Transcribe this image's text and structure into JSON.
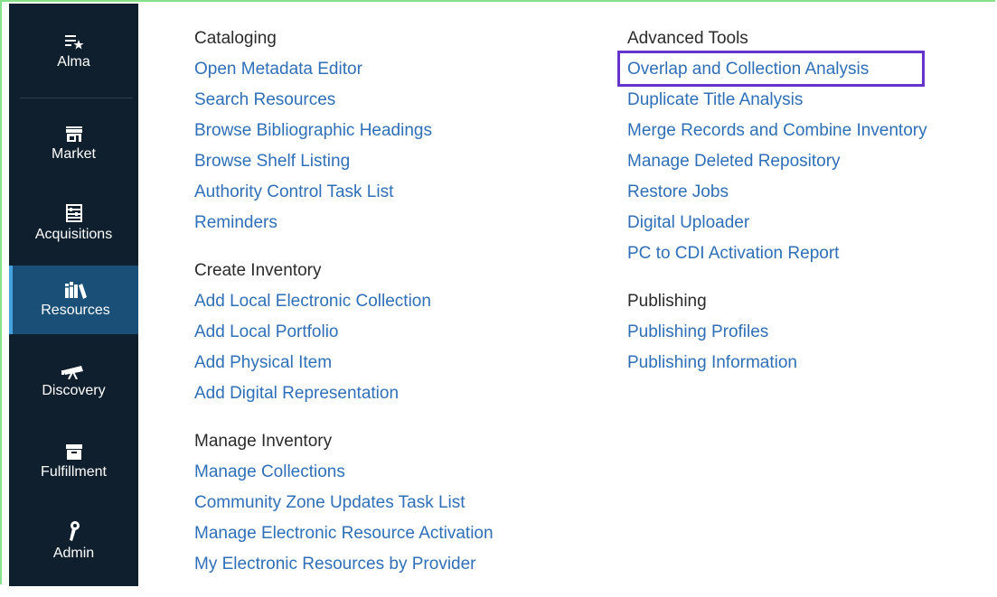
{
  "sidebar": {
    "items": [
      {
        "label": "Alma",
        "icon": "alma-star-icon"
      },
      {
        "label": "Market",
        "icon": "market-store-icon"
      },
      {
        "label": "Acquisitions",
        "icon": "acquisitions-abacus-icon"
      },
      {
        "label": "Resources",
        "icon": "resources-books-icon",
        "active": true
      },
      {
        "label": "Discovery",
        "icon": "discovery-telescope-icon"
      },
      {
        "label": "Fulfillment",
        "icon": "fulfillment-archive-icon"
      },
      {
        "label": "Admin",
        "icon": "admin-wrench-icon"
      }
    ],
    "active_color": "#1a4f78",
    "background_color": "#0f1f2e"
  },
  "menu": {
    "cataloging": {
      "heading": "Cataloging",
      "links": [
        "Open Metadata Editor",
        "Search Resources",
        "Browse Bibliographic Headings",
        "Browse Shelf Listing",
        "Authority Control Task List",
        "Reminders"
      ]
    },
    "create_inventory": {
      "heading": "Create Inventory",
      "links": [
        "Add Local Electronic Collection",
        "Add Local Portfolio",
        "Add Physical Item",
        "Add Digital Representation"
      ]
    },
    "manage_inventory": {
      "heading": "Manage Inventory",
      "links": [
        "Manage Collections",
        "Community Zone Updates Task List",
        "Manage Electronic Resource Activation",
        "My Electronic Resources by Provider"
      ]
    },
    "advanced_tools": {
      "heading": "Advanced Tools",
      "links": [
        "Overlap and Collection Analysis",
        "Duplicate Title Analysis",
        "Merge Records and Combine Inventory",
        "Manage Deleted Repository",
        "Restore Jobs",
        "Digital Uploader",
        "PC to CDI Activation Report"
      ]
    },
    "publishing": {
      "heading": "Publishing",
      "links": [
        "Publishing Profiles",
        "Publishing Information"
      ]
    }
  },
  "colors": {
    "link": "#2f6fb8",
    "highlight": "#6633cc",
    "frame": "#86e08a"
  }
}
